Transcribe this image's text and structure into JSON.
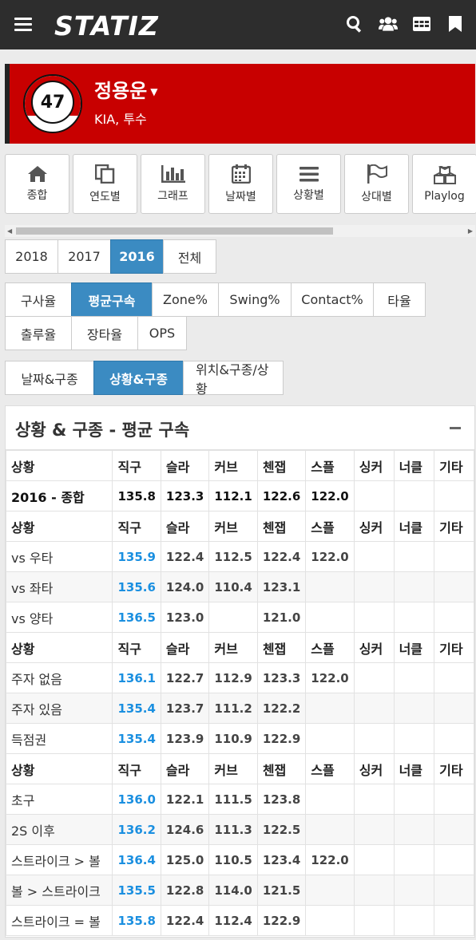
{
  "header": {
    "logo": "STATIZ",
    "icons": [
      "menu-icon",
      "search-icon",
      "users-icon",
      "table-icon",
      "bookmark-icon"
    ]
  },
  "player": {
    "number": "47",
    "name": "정용운",
    "team_pos": "KIA, 투수"
  },
  "menu": [
    {
      "label": "종합",
      "icon": "home-icon"
    },
    {
      "label": "연도별",
      "icon": "copy-icon"
    },
    {
      "label": "그래프",
      "icon": "bar-chart-icon"
    },
    {
      "label": "날짜별",
      "icon": "calendar-icon"
    },
    {
      "label": "상황별",
      "icon": "list-icon"
    },
    {
      "label": "상대별",
      "icon": "flag-icon"
    },
    {
      "label": "Playlog",
      "icon": "cubes-icon"
    }
  ],
  "years": [
    "2018",
    "2017",
    "2016",
    "전체"
  ],
  "year_active": "2016",
  "stat_tabs": [
    "구사율",
    "평균구속",
    "Zone%",
    "Swing%",
    "Contact%",
    "타율",
    "출루율",
    "장타율",
    "OPS"
  ],
  "stat_active": "평균구속",
  "view_tabs": [
    "날짜&구종",
    "상황&구종",
    "위치&구종/상황"
  ],
  "view_active": "상황&구종",
  "panel": {
    "title": "상황 & 구종 - 평균 구속"
  },
  "table": {
    "headers": [
      "상황",
      "직구",
      "슬라",
      "커브",
      "첸잽",
      "스플",
      "싱커",
      "너클",
      "기타"
    ],
    "summary": [
      "2016 - 종합",
      "135.8",
      "123.3",
      "112.1",
      "122.6",
      "122.0",
      "",
      "",
      ""
    ],
    "groups": [
      [
        [
          "vs 우타",
          "135.9",
          "122.4",
          "112.5",
          "122.4",
          "122.0",
          "",
          "",
          ""
        ],
        [
          "vs 좌타",
          "135.6",
          "124.0",
          "110.4",
          "123.1",
          "",
          "",
          "",
          ""
        ],
        [
          "vs 양타",
          "136.5",
          "123.0",
          "",
          "121.0",
          "",
          "",
          "",
          ""
        ]
      ],
      [
        [
          "주자 없음",
          "136.1",
          "122.7",
          "112.9",
          "123.3",
          "122.0",
          "",
          "",
          ""
        ],
        [
          "주자 있음",
          "135.4",
          "123.7",
          "111.2",
          "122.2",
          "",
          "",
          "",
          ""
        ],
        [
          "득점권",
          "135.4",
          "123.9",
          "110.9",
          "122.9",
          "",
          "",
          "",
          ""
        ]
      ],
      [
        [
          "초구",
          "136.0",
          "122.1",
          "111.5",
          "123.8",
          "",
          "",
          "",
          ""
        ],
        [
          "2S 이후",
          "136.2",
          "124.6",
          "111.3",
          "122.5",
          "",
          "",
          "",
          ""
        ],
        [
          "스트라이크 > 볼",
          "136.4",
          "125.0",
          "110.5",
          "123.4",
          "122.0",
          "",
          "",
          ""
        ],
        [
          "볼 > 스트라이크",
          "135.5",
          "122.8",
          "114.0",
          "121.5",
          "",
          "",
          "",
          ""
        ],
        [
          "스트라이크 = 볼",
          "135.8",
          "122.4",
          "112.4",
          "122.9",
          "",
          "",
          "",
          ""
        ]
      ]
    ]
  }
}
